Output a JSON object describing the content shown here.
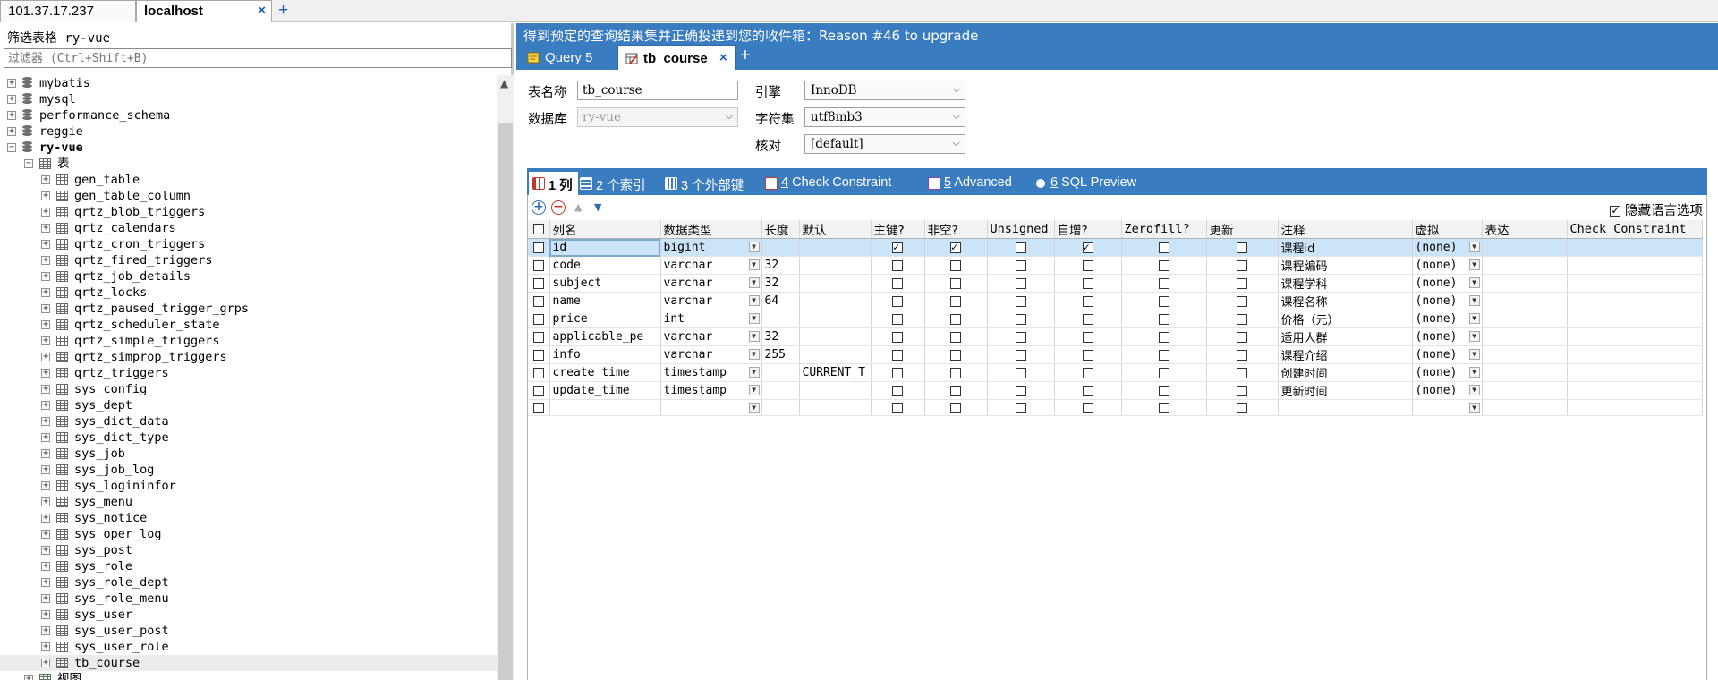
{
  "connections": [
    {
      "label": "101.37.17.237",
      "active": false
    },
    {
      "label": "localhost",
      "active": true,
      "close": "×"
    }
  ],
  "conn_add": "+",
  "filter": {
    "title": "筛选表格 ry-vue",
    "placeholder": "过滤器 (Ctrl+Shift+B)"
  },
  "tree": {
    "databases": [
      "mybatis",
      "mysql",
      "performance_schema",
      "reggie",
      "ry-vue"
    ],
    "tables_node": "表",
    "tables": [
      "gen_table",
      "gen_table_column",
      "qrtz_blob_triggers",
      "qrtz_calendars",
      "qrtz_cron_triggers",
      "qrtz_fired_triggers",
      "qrtz_job_details",
      "qrtz_locks",
      "qrtz_paused_trigger_grps",
      "qrtz_scheduler_state",
      "qrtz_simple_triggers",
      "qrtz_simprop_triggers",
      "qrtz_triggers",
      "sys_config",
      "sys_dept",
      "sys_dict_data",
      "sys_dict_type",
      "sys_job",
      "sys_job_log",
      "sys_logininfor",
      "sys_menu",
      "sys_notice",
      "sys_oper_log",
      "sys_post",
      "sys_role",
      "sys_role_dept",
      "sys_role_menu",
      "sys_user",
      "sys_user_post",
      "sys_user_role",
      "tb_course"
    ],
    "views_node": "视图",
    "selected": "tb_course"
  },
  "banner": "得到预定的查询结果集并正确投递到您的收件箱：Reason #46 to upgrade",
  "query_tabs": [
    {
      "label": "Query 5"
    },
    {
      "label": "tb_course",
      "close": "×"
    }
  ],
  "query_add": "+",
  "form": {
    "table_name_label": "表名称",
    "table_name": "tb_course",
    "database_label": "数据库",
    "database": "ry-vue",
    "engine_label": "引擎",
    "engine": "InnoDB",
    "charset_label": "字符集",
    "charset": "utf8mb3",
    "collation_label": "核对",
    "collation": "[default]"
  },
  "subtabs": [
    {
      "num": "1",
      "label": "列",
      "icon_color": "#c0392b"
    },
    {
      "num": "2",
      "label": "个索引",
      "icon_color": "#2a6db5"
    },
    {
      "num": "3",
      "label": "个外部键",
      "icon_color": "#2a6db5"
    },
    {
      "num": "4",
      "label": "Check Constraint",
      "icon_color": "#c0392b"
    },
    {
      "num": "5",
      "label": "Advanced",
      "icon_color": "#8e44ad"
    },
    {
      "num": "6",
      "label": "SQL Preview",
      "icon_color": "#555555"
    }
  ],
  "toolbar": {
    "add": "+",
    "remove": "−",
    "up": "▲",
    "down": "▼",
    "hide_lang_options": "隐藏语言选项",
    "hide_lang_checked": true
  },
  "grid": {
    "headers": [
      "列名",
      "数据类型",
      "长度",
      "默认",
      "主键?",
      "非空?",
      "Unsigned",
      "自增?",
      "Zerofill?",
      "更新",
      "注释",
      "虚拟",
      "表达",
      "Check Constraint"
    ],
    "rows": [
      {
        "name": "id",
        "type": "bigint",
        "length": "",
        "default": "",
        "pk": true,
        "nn": true,
        "unsigned": false,
        "ai": true,
        "zf": false,
        "upd": false,
        "comment": "课程id",
        "virtual": "(none)"
      },
      {
        "name": "code",
        "type": "varchar",
        "length": "32",
        "default": "",
        "pk": false,
        "nn": false,
        "unsigned": false,
        "ai": false,
        "zf": false,
        "upd": false,
        "comment": "课程编码",
        "virtual": "(none)"
      },
      {
        "name": "subject",
        "type": "varchar",
        "length": "32",
        "default": "",
        "pk": false,
        "nn": false,
        "unsigned": false,
        "ai": false,
        "zf": false,
        "upd": false,
        "comment": "课程学科",
        "virtual": "(none)"
      },
      {
        "name": "name",
        "type": "varchar",
        "length": "64",
        "default": "",
        "pk": false,
        "nn": false,
        "unsigned": false,
        "ai": false,
        "zf": false,
        "upd": false,
        "comment": "课程名称",
        "virtual": "(none)"
      },
      {
        "name": "price",
        "type": "int",
        "length": "",
        "default": "",
        "pk": false,
        "nn": false,
        "unsigned": false,
        "ai": false,
        "zf": false,
        "upd": false,
        "comment": "价格（元）",
        "virtual": "(none)"
      },
      {
        "name": "applicable_pe",
        "type": "varchar",
        "length": "32",
        "default": "",
        "pk": false,
        "nn": false,
        "unsigned": false,
        "ai": false,
        "zf": false,
        "upd": false,
        "comment": "适用人群",
        "virtual": "(none)"
      },
      {
        "name": "info",
        "type": "varchar",
        "length": "255",
        "default": "",
        "pk": false,
        "nn": false,
        "unsigned": false,
        "ai": false,
        "zf": false,
        "upd": false,
        "comment": "课程介绍",
        "virtual": "(none)"
      },
      {
        "name": "create_time",
        "type": "timestamp",
        "length": "",
        "default": "CURRENT_T",
        "pk": false,
        "nn": false,
        "unsigned": false,
        "ai": false,
        "zf": false,
        "upd": false,
        "comment": "创建时间",
        "virtual": "(none)"
      },
      {
        "name": "update_time",
        "type": "timestamp",
        "length": "",
        "default": "",
        "pk": false,
        "nn": false,
        "unsigned": false,
        "ai": false,
        "zf": false,
        "upd": false,
        "comment": "更新时间",
        "virtual": "(none)"
      },
      {
        "name": "",
        "type": "",
        "length": "",
        "default": "",
        "pk": false,
        "nn": false,
        "unsigned": false,
        "ai": false,
        "zf": false,
        "upd": false,
        "comment": "",
        "virtual": "",
        "empty": true
      }
    ]
  },
  "colors": {
    "accent": "#3a7cc0",
    "selected_row": "#cce4f7",
    "tab_close": "#1a5fb4"
  }
}
